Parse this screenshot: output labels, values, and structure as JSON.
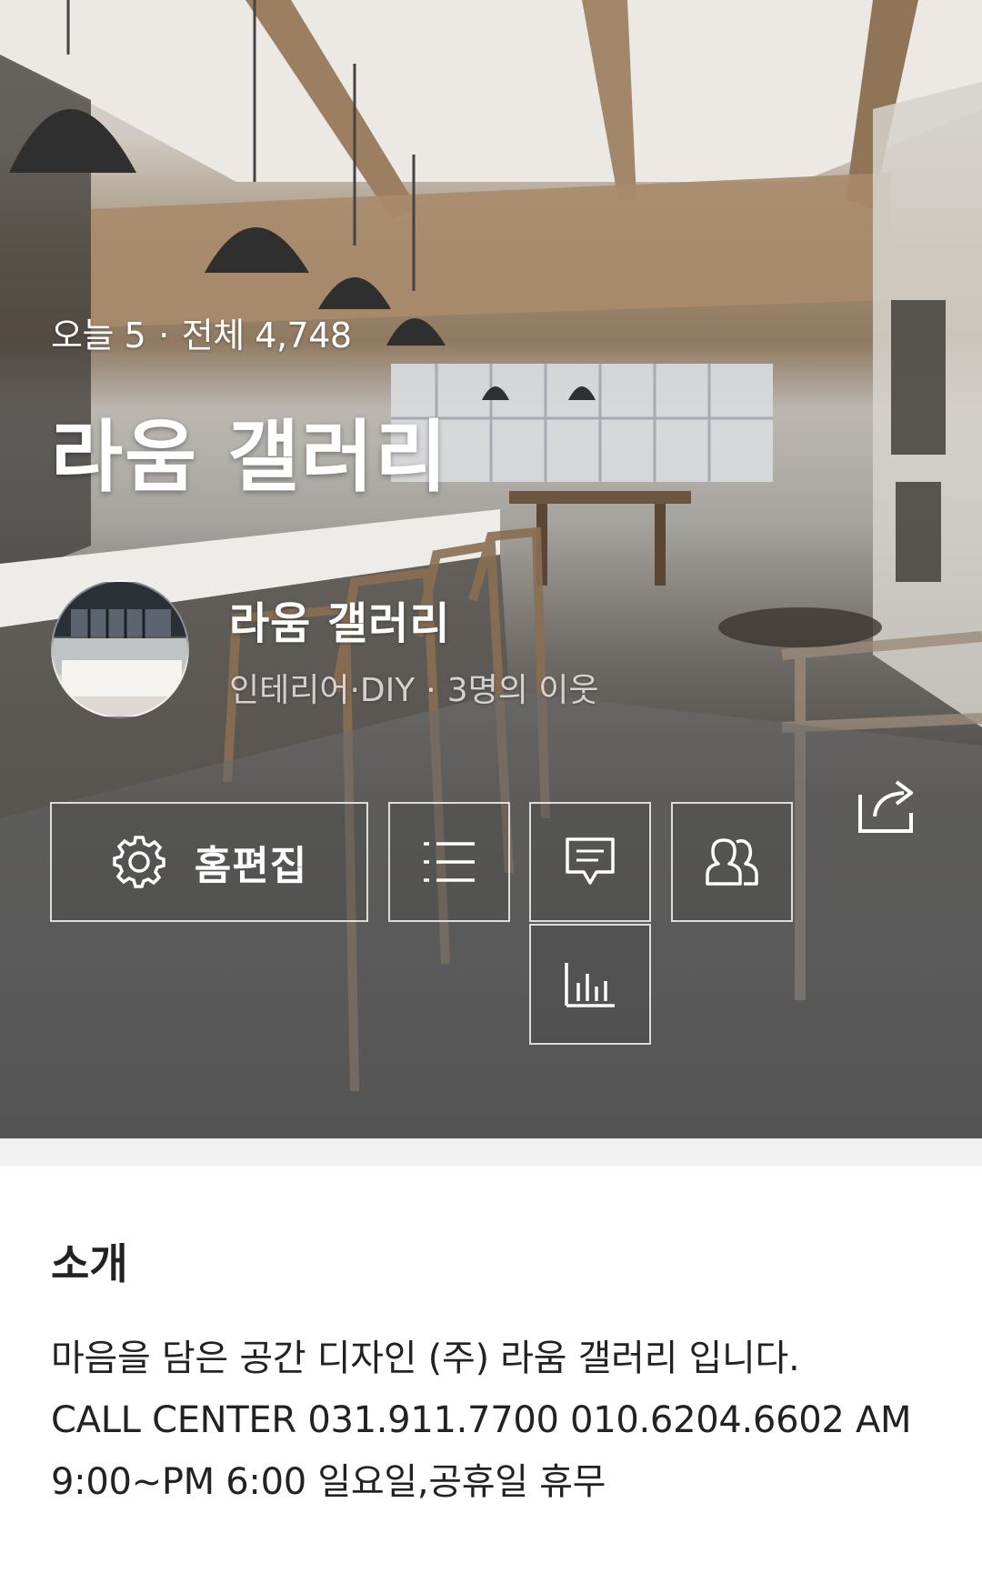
{
  "hero": {
    "today_label": "오늘 5",
    "total_label": "전체 4,748",
    "dot": "·",
    "blog_title": "라움 갤러리"
  },
  "profile": {
    "name": "라움 갤러리",
    "category": "인테리어·DIY",
    "dot": "·",
    "neighbors": "3명의 이웃"
  },
  "actions": {
    "edit_label": "홈편집",
    "edit_icon": "gear-icon",
    "list_icon": "list-icon",
    "comment_icon": "comment-icon",
    "neighbor_icon": "people-icon",
    "stats_icon": "bar-chart-icon",
    "share_icon": "share-icon"
  },
  "intro": {
    "heading": "소개",
    "line1": "마음을 담은 공간 디자인 (주) 라움 갤러리 입니다.",
    "line2": "CALL CENTER 031.911.7700 010.6204.6602 AM",
    "line3": "9:00~PM 6:00 일요일,공휴일 휴무"
  },
  "colors": {
    "text_dark": "#222222",
    "divider": "#f2f2f2",
    "hero_text": "#ffffff"
  }
}
